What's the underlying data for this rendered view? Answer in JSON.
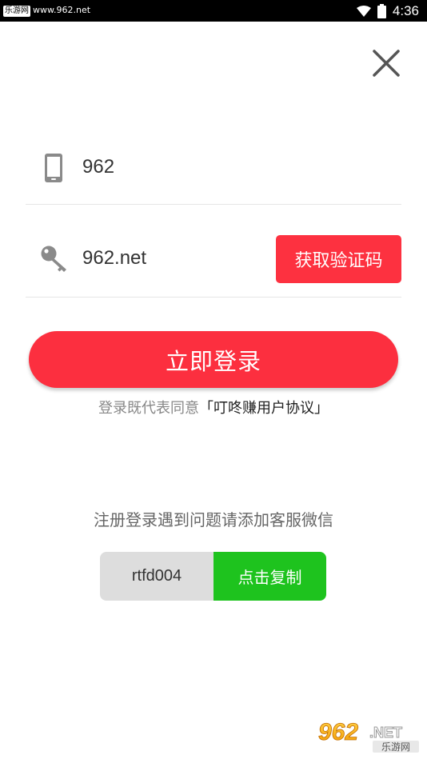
{
  "status_bar": {
    "site_tag": "乐游网",
    "site_url": "www.962.net",
    "time": "4:36"
  },
  "form": {
    "phone_value": "962",
    "code_value": "962.net",
    "get_code_label": "获取验证码"
  },
  "login_label": "立即登录",
  "agreement": {
    "prefix": "登录既代表同意",
    "link": "「叮咚赚用户协议」"
  },
  "help": {
    "text": "注册登录遇到问题请添加客服微信",
    "wechat_id": "rtfd004",
    "copy_label": "点击复制"
  },
  "watermark": {
    "brand": "962",
    "suffix": ".NET",
    "sub": "乐游网"
  },
  "colors": {
    "accent_red": "#fd3140",
    "copy_green": "#1ec31e",
    "icon_gray": "#8a8a8a"
  },
  "icons": [
    "wifi-icon",
    "battery-icon",
    "close-icon",
    "phone-icon",
    "key-icon"
  ]
}
